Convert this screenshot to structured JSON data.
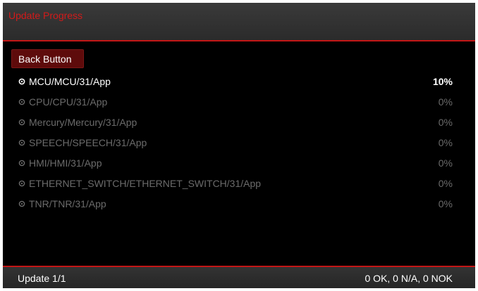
{
  "header": {
    "title": "Update Progress"
  },
  "back_button": {
    "label": "Back Button"
  },
  "apps": [
    {
      "name": "MCU/MCU/31/App",
      "progress": "10%",
      "active": true
    },
    {
      "name": "CPU/CPU/31/App",
      "progress": "0%",
      "active": false
    },
    {
      "name": "Mercury/Mercury/31/App",
      "progress": "0%",
      "active": false
    },
    {
      "name": "SPEECH/SPEECH/31/App",
      "progress": "0%",
      "active": false
    },
    {
      "name": "HMI/HMI/31/App",
      "progress": "0%",
      "active": false
    },
    {
      "name": "ETHERNET_SWITCH/ETHERNET_SWITCH/31/App",
      "progress": "0%",
      "active": false
    },
    {
      "name": "TNR/TNR/31/App",
      "progress": "0%",
      "active": false
    }
  ],
  "footer": {
    "update_count": "Update 1/1",
    "summary": "0 OK, 0 N/A, 0 NOK"
  },
  "colors": {
    "accent_red": "#c41616",
    "header_text": "#d21a1a",
    "button_bg": "#5e0b0b",
    "active_text": "#ffffff",
    "inactive_text": "#6b6b6b",
    "background": "#000000"
  },
  "icons": {
    "bullet": "radio-bullet-icon"
  }
}
